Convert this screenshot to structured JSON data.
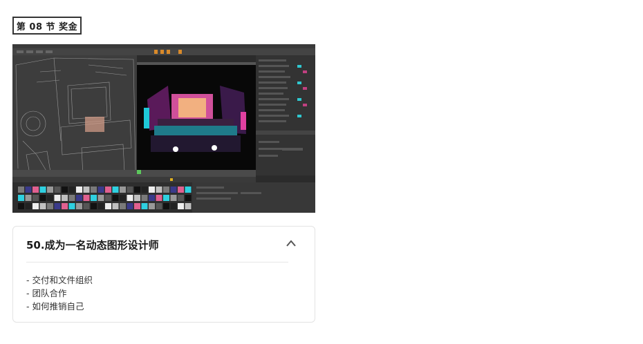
{
  "section": {
    "label": "第 08 节 奖金"
  },
  "preview": {
    "description_icon": "video-thumbnail"
  },
  "card": {
    "title": "50.成为一名动态图形设计师",
    "expanded": true,
    "items": [
      "- 交付和文件组织",
      "- 团队合作",
      "- 如何推销自己"
    ]
  }
}
